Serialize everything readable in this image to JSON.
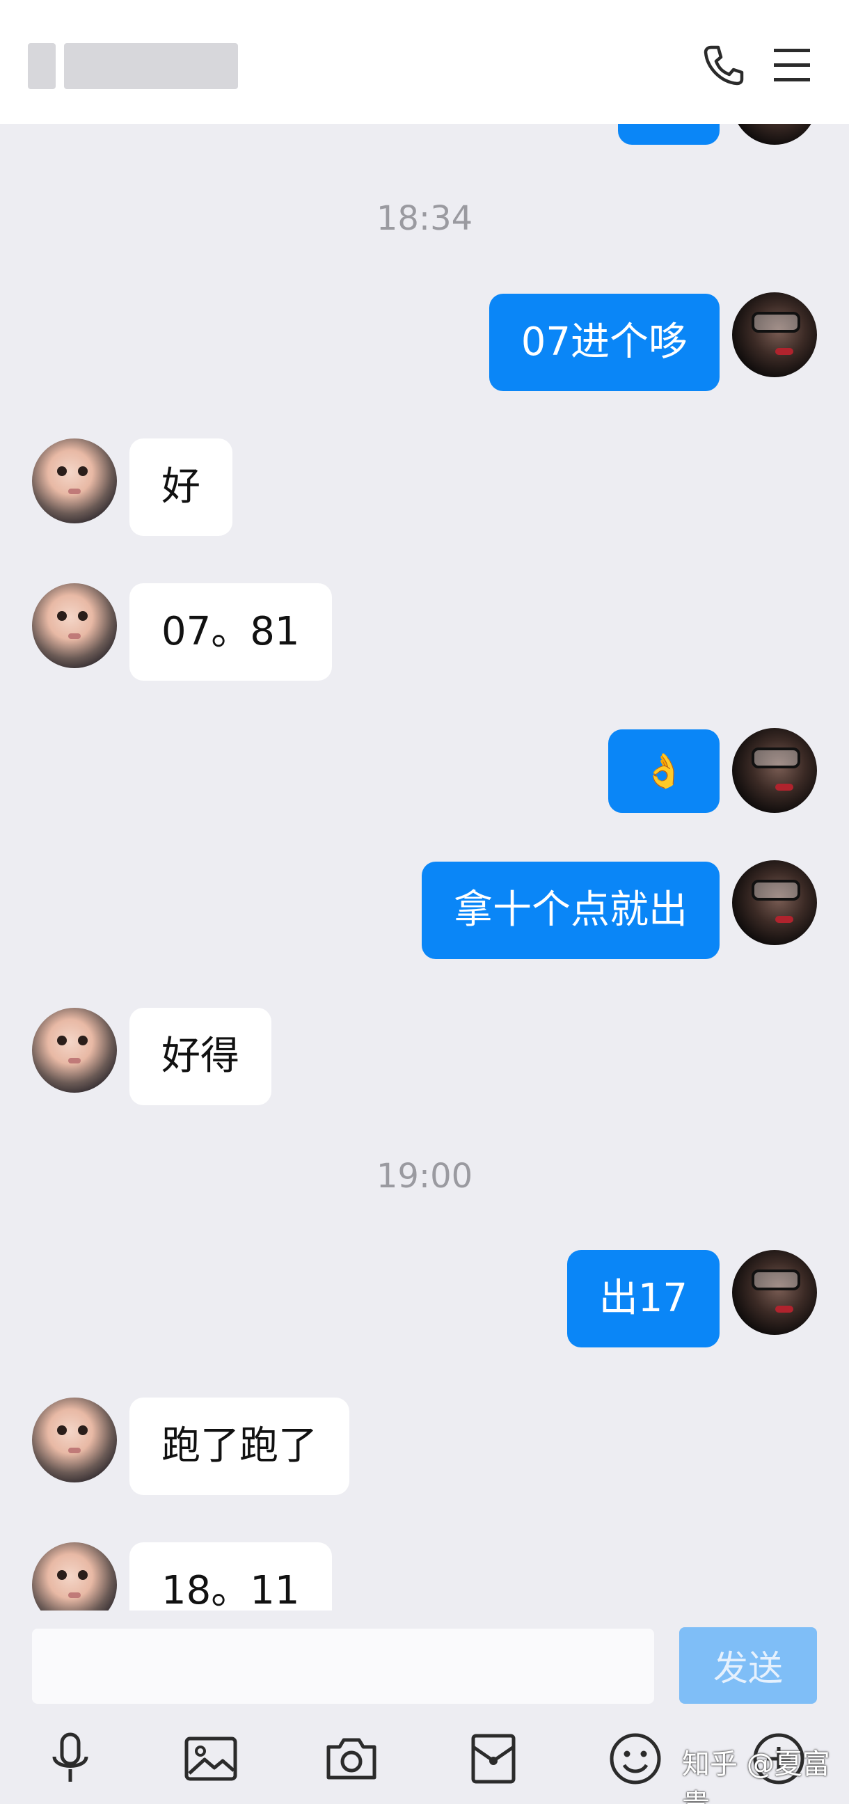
{
  "header": {
    "title": "▮ ▮▮▮▮▮▮",
    "phone_icon": "phone-icon",
    "menu_icon": "menu-icon"
  },
  "messages": {
    "partial_top": "",
    "time1": "18:34",
    "m1": "07进个哆",
    "m2": "好",
    "m3": "07。81",
    "m4": "👌",
    "m5": "拿十个点就出",
    "m6": "好得",
    "time2": "19:00",
    "m7": "出17",
    "m8": "跑了跑了",
    "m9": "18。11"
  },
  "input": {
    "placeholder": "",
    "send_label": "发送"
  },
  "toolbar": {
    "icons": [
      "microphone-icon",
      "image-icon",
      "camera-icon",
      "red-packet-icon",
      "emoji-icon",
      "plus-icon"
    ]
  },
  "watermark": "知乎 @夏富贵",
  "colors": {
    "my_bubble": "#0a86f7",
    "their_bubble": "#ffffff",
    "background": "#ededf2",
    "send_disabled": "#7fbef7"
  }
}
